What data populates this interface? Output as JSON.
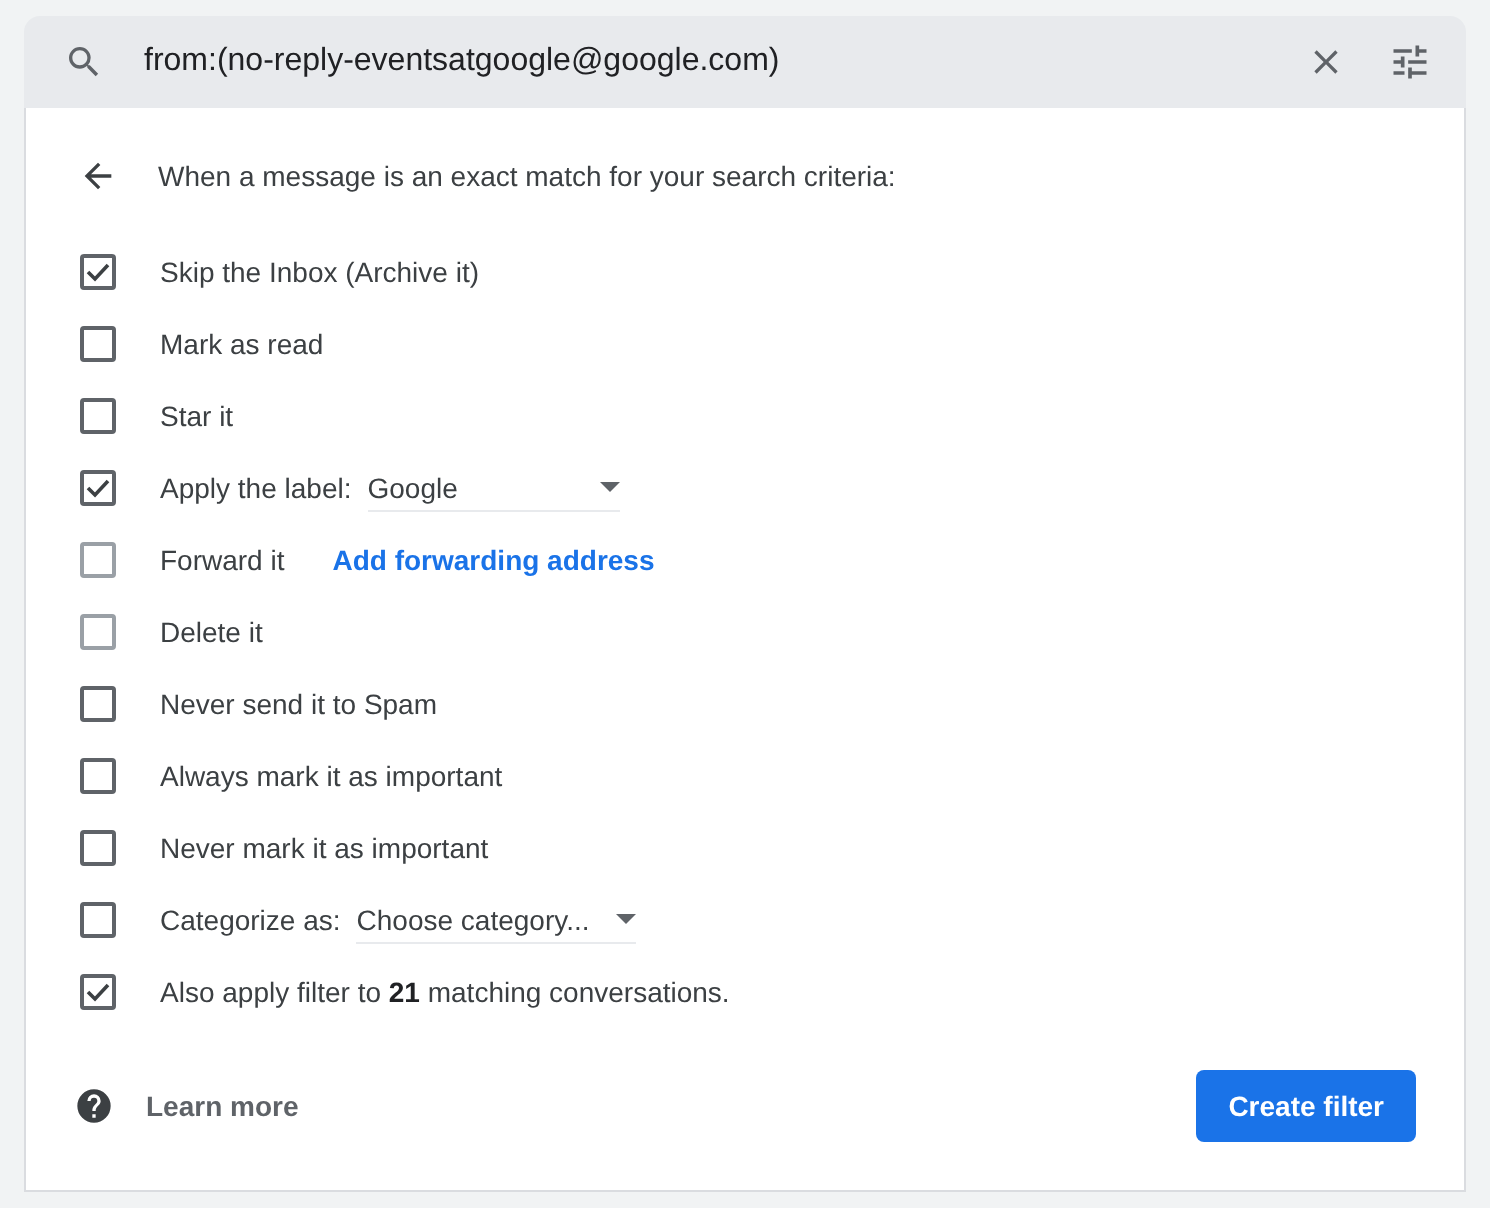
{
  "search": {
    "query": "from:(no-reply-eventsatgoogle@google.com)"
  },
  "header": "When a message is an exact match for your search criteria:",
  "options": [
    {
      "kind": "plain",
      "label": "Skip the Inbox (Archive it)",
      "checked": true,
      "disabled": false
    },
    {
      "kind": "plain",
      "label": "Mark as read",
      "checked": false,
      "disabled": false
    },
    {
      "kind": "plain",
      "label": "Star it",
      "checked": false,
      "disabled": false
    },
    {
      "kind": "select",
      "label": "Apply the label:",
      "value": "Google",
      "checked": true,
      "disabled": false
    },
    {
      "kind": "link",
      "label": "Forward it",
      "link": "Add forwarding address",
      "checked": false,
      "disabled": true
    },
    {
      "kind": "plain",
      "label": "Delete it",
      "checked": false,
      "disabled": true
    },
    {
      "kind": "plain",
      "label": "Never send it to Spam",
      "checked": false,
      "disabled": false
    },
    {
      "kind": "plain",
      "label": "Always mark it as important",
      "checked": false,
      "disabled": false
    },
    {
      "kind": "plain",
      "label": "Never mark it as important",
      "checked": false,
      "disabled": false
    },
    {
      "kind": "select",
      "label": "Categorize as:",
      "value": "Choose category...",
      "checked": false,
      "disabled": false
    },
    {
      "kind": "plain",
      "label": "Also apply filter to **21** matching conversations.",
      "checked": true,
      "disabled": false
    }
  ],
  "footer": {
    "learn_more": "Learn more",
    "button": "Create filter"
  }
}
